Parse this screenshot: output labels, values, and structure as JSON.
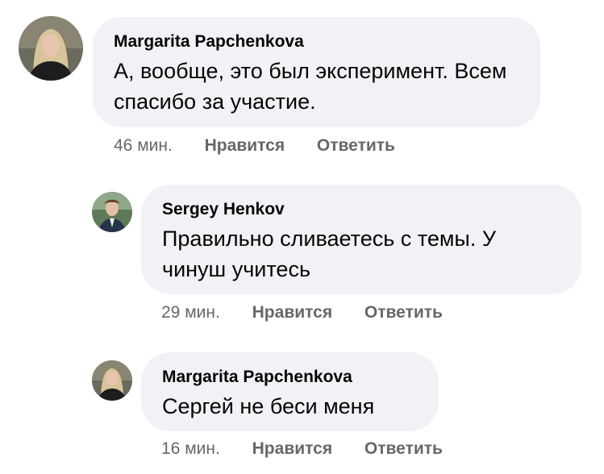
{
  "comments": [
    {
      "author": "Margarita Papchenkova",
      "text": "А, вообще, это был эксперимент. Всем спасибо за участие.",
      "time": "46 мин.",
      "like": "Нравится",
      "reply": "Ответить"
    },
    {
      "author": "Sergey Henkov",
      "text": "Правильно сливаетесь с темы. У чинуш учитесь",
      "time": "29 мин.",
      "like": "Нравится",
      "reply": "Ответить"
    },
    {
      "author": "Margarita Papchenkova",
      "text": "Сергей не беси меня",
      "time": "16 мин.",
      "like": "Нравится",
      "reply": "Ответить"
    }
  ],
  "colors": {
    "bubble_bg": "#f0f2f5",
    "text": "#050505",
    "meta": "#65676b"
  }
}
